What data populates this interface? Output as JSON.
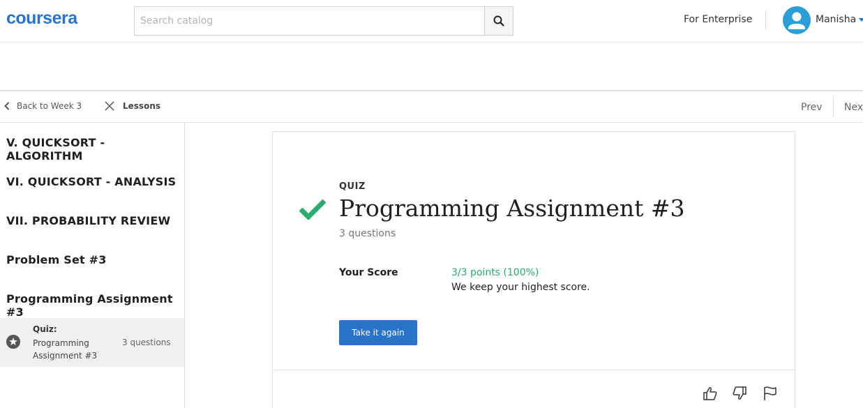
{
  "header": {
    "logo": "coursera",
    "search_placeholder": "Search catalog",
    "enterprise_link": "For Enterprise",
    "user_name": "Manisha"
  },
  "subnav": {
    "back_label": "Back to Week 3",
    "lessons_label": "Lessons",
    "prev_label": "Prev",
    "next_label": "Next"
  },
  "sidebar": {
    "items": [
      {
        "label": "V. QUICKSORT - ALGORITHM"
      },
      {
        "label": "VI. QUICKSORT - ANALYSIS"
      },
      {
        "label": "VII. PROBABILITY REVIEW"
      },
      {
        "label": "Problem Set #3"
      },
      {
        "label": "Programming Assignment #3"
      }
    ],
    "active_lesson": {
      "type": "Quiz:",
      "name": "Programming Assignment #3",
      "count": "3 questions"
    }
  },
  "main": {
    "item_type": "QUIZ",
    "title": "Programming Assignment #3",
    "subtitle": "3 questions",
    "score_label": "Your Score",
    "score_value": "3/3 points (100%)",
    "score_note": "We keep your highest score.",
    "retake_button": "Take it again"
  },
  "colors": {
    "brand": "#2a73cc",
    "success": "#2bac6e"
  }
}
